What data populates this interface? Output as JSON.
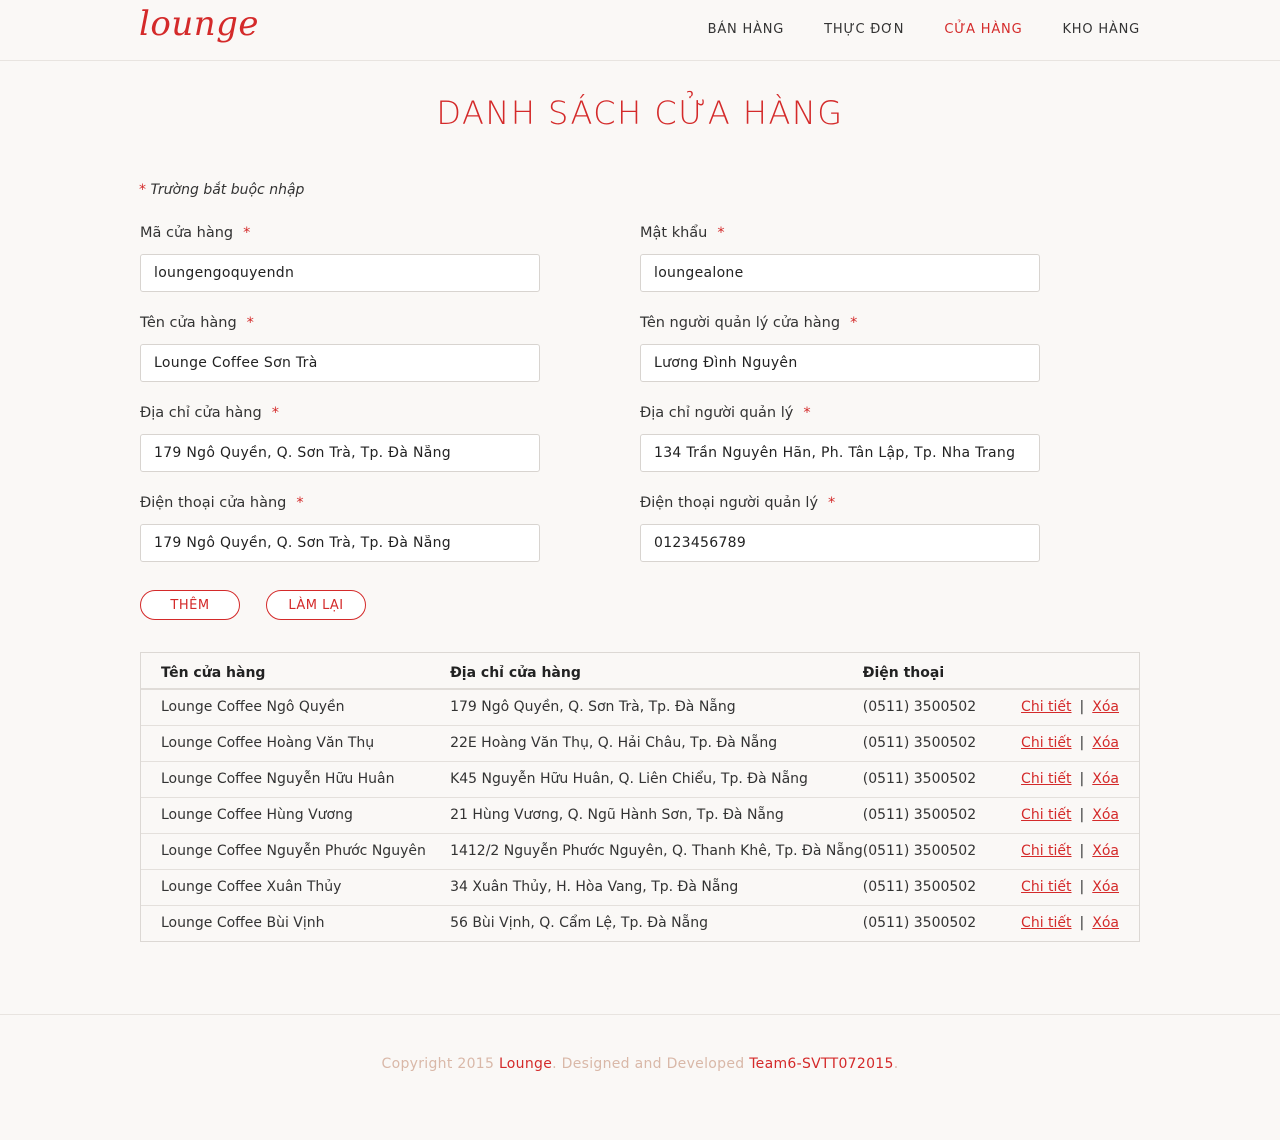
{
  "header": {
    "logo": "lounge",
    "nav": [
      "BÁN HÀNG",
      "THỰC ĐƠN",
      "CỬA HÀNG",
      "KHO HÀNG"
    ]
  },
  "page_title": "DANH SÁCH CỬA HÀNG",
  "required_note": {
    "star": "*",
    "text": "Trường bắt buộc nhập"
  },
  "form": {
    "store_code": {
      "label": "Mã cửa hàng",
      "value": "loungengoquyendn"
    },
    "password": {
      "label": "Mật khẩu",
      "value": "loungealone"
    },
    "store_name": {
      "label": "Tên cửa hàng",
      "value": "Lounge Coffee Sơn Trà"
    },
    "manager_name": {
      "label": "Tên người quản lý cửa hàng",
      "value": "Lương Đình Nguyên"
    },
    "store_address": {
      "label": "Địa chỉ cửa hàng",
      "value": "179 Ngô Quyền, Q. Sơn Trà, Tp. Đà Nẵng"
    },
    "manager_address": {
      "label": "Địa chỉ người quản lý",
      "value": "134 Trần Nguyên Hãn, Ph. Tân Lập, Tp. Nha Trang"
    },
    "store_phone": {
      "label": "Điện thoại cửa hàng",
      "value": "179 Ngô Quyền, Q. Sơn Trà, Tp. Đà Nẵng"
    },
    "manager_phone": {
      "label": "Điện thoại người quản lý",
      "value": "0123456789"
    },
    "star": "*",
    "add_label": "THÊM",
    "reset_label": "LÀM LẠI"
  },
  "table": {
    "headers": [
      "Tên cửa hàng",
      "Địa chỉ cửa hàng",
      "Điện thoại"
    ],
    "detail_label": "Chi tiết",
    "delete_label": "Xóa",
    "separator": "|",
    "rows": [
      {
        "name": "Lounge Coffee Ngô Quyền",
        "address": "179 Ngô Quyền, Q. Sơn Trà, Tp. Đà Nẵng",
        "phone": "(0511) 3500502"
      },
      {
        "name": "Lounge Coffee Hoàng Văn Thụ",
        "address": "22E Hoàng Văn Thụ, Q. Hải Châu, Tp. Đà Nẵng",
        "phone": "(0511) 3500502"
      },
      {
        "name": "Lounge Coffee Nguyễn Hữu Huân",
        "address": "K45 Nguyễn Hữu Huân, Q. Liên Chiểu, Tp. Đà Nẵng",
        "phone": "(0511) 3500502"
      },
      {
        "name": "Lounge Coffee Hùng Vương",
        "address": "21 Hùng Vương, Q. Ngũ Hành Sơn, Tp. Đà Nẵng",
        "phone": "(0511) 3500502"
      },
      {
        "name": "Lounge Coffee Nguyễn Phước Nguyên",
        "address": "1412/2 Nguyễn Phước Nguyên, Q. Thanh Khê, Tp. Đà Nẵng",
        "phone": "(0511) 3500502"
      },
      {
        "name": "Lounge Coffee Xuân Thủy",
        "address": "34 Xuân Thủy, H. Hòa Vang, Tp. Đà Nẵng",
        "phone": "(0511) 3500502"
      },
      {
        "name": "Lounge Coffee Bùi Vịnh",
        "address": "56 Bùi Vịnh, Q. Cẩm Lệ, Tp. Đà Nẵng",
        "phone": "(0511) 3500502"
      }
    ]
  },
  "footer": {
    "prefix": "Copyright 2015 ",
    "brand": "Lounge",
    "middle": ". Designed and Developed ",
    "team": "Team6-SVTT072015",
    "suffix": "."
  },
  "colors": {
    "accent": "#d42a2a",
    "background": "#faf8f6",
    "footer_text": "#d9b8a8"
  }
}
